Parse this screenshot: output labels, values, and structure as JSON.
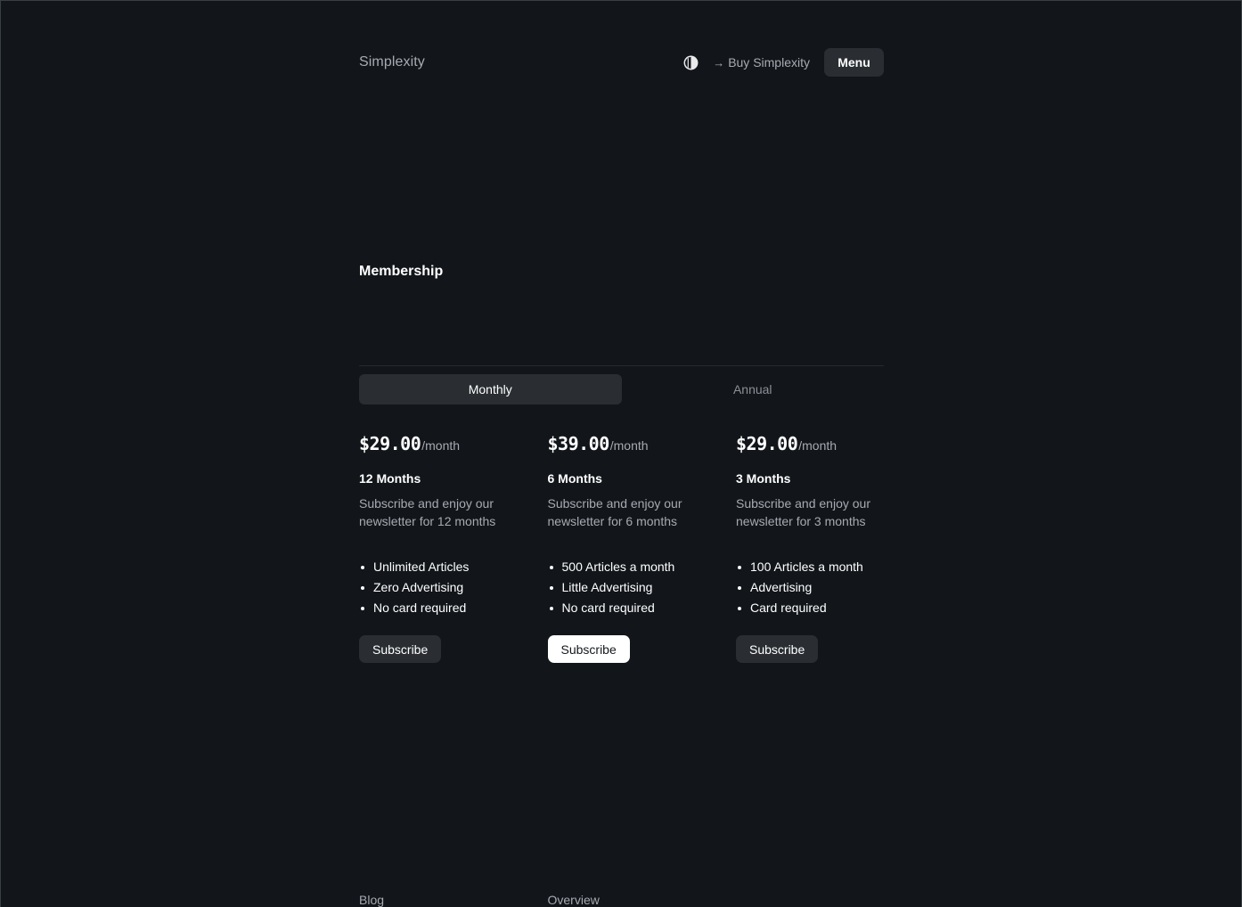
{
  "header": {
    "brand": "Simplexity",
    "theme_icon": "contrast-icon",
    "buy_label": "Buy Simplexity",
    "menu_label": "Menu"
  },
  "section": {
    "title": "Membership"
  },
  "tabs": [
    {
      "label": "Monthly",
      "active": true
    },
    {
      "label": "Annual",
      "active": false
    }
  ],
  "plans": [
    {
      "price": "$29.00",
      "per": "/month",
      "name": "12 Months",
      "description": "Subscribe and enjoy our newsletter for 12 months",
      "features": [
        "Unlimited Articles",
        "Zero Advertising",
        "No card required"
      ],
      "button": "Subscribe",
      "highlighted": false
    },
    {
      "price": "$39.00",
      "per": "/month",
      "name": "6 Months",
      "description": "Subscribe and enjoy our newsletter for 6 months",
      "features": [
        "500 Articles a month",
        "Little Advertising",
        "No card required"
      ],
      "button": "Subscribe",
      "highlighted": true
    },
    {
      "price": "$29.00",
      "per": "/month",
      "name": "3 Months",
      "description": "Subscribe and enjoy our newsletter for 3 months",
      "features": [
        "100 Articles a month",
        "Advertising",
        "Card required"
      ],
      "button": "Subscribe",
      "highlighted": false
    }
  ],
  "footer": {
    "links": [
      "Blog",
      "Overview"
    ]
  },
  "colors": {
    "background": "#12161b",
    "surface": "#2a2e33",
    "text": "#ffffff",
    "muted": "#a7abb1"
  }
}
